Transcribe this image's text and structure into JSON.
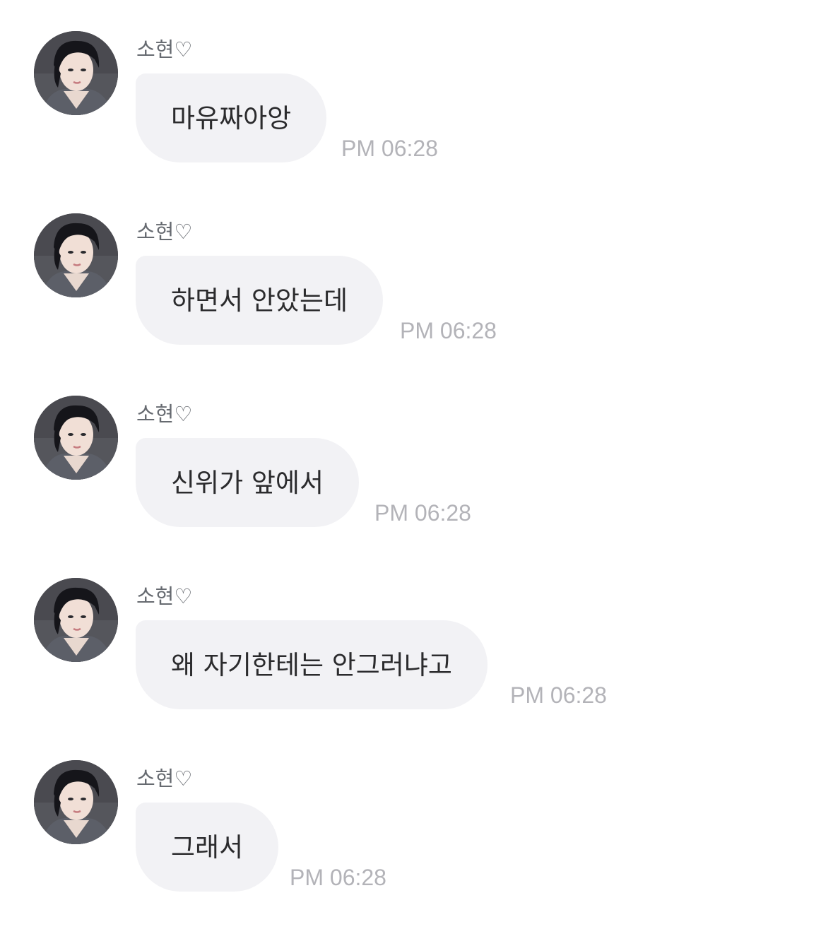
{
  "messages": [
    {
      "sender": "소현♡",
      "text": "마유짜아앙",
      "time": "PM 06:28"
    },
    {
      "sender": "소현♡",
      "text": "하면서 안았는데",
      "time": "PM 06:28"
    },
    {
      "sender": "소현♡",
      "text": "신위가 앞에서",
      "time": "PM 06:28"
    },
    {
      "sender": "소현♡",
      "text": "왜 자기한테는 안그러냐고",
      "time": "PM 06:28"
    },
    {
      "sender": "소현♡",
      "text": "그래서",
      "time": "PM 06:28"
    }
  ]
}
